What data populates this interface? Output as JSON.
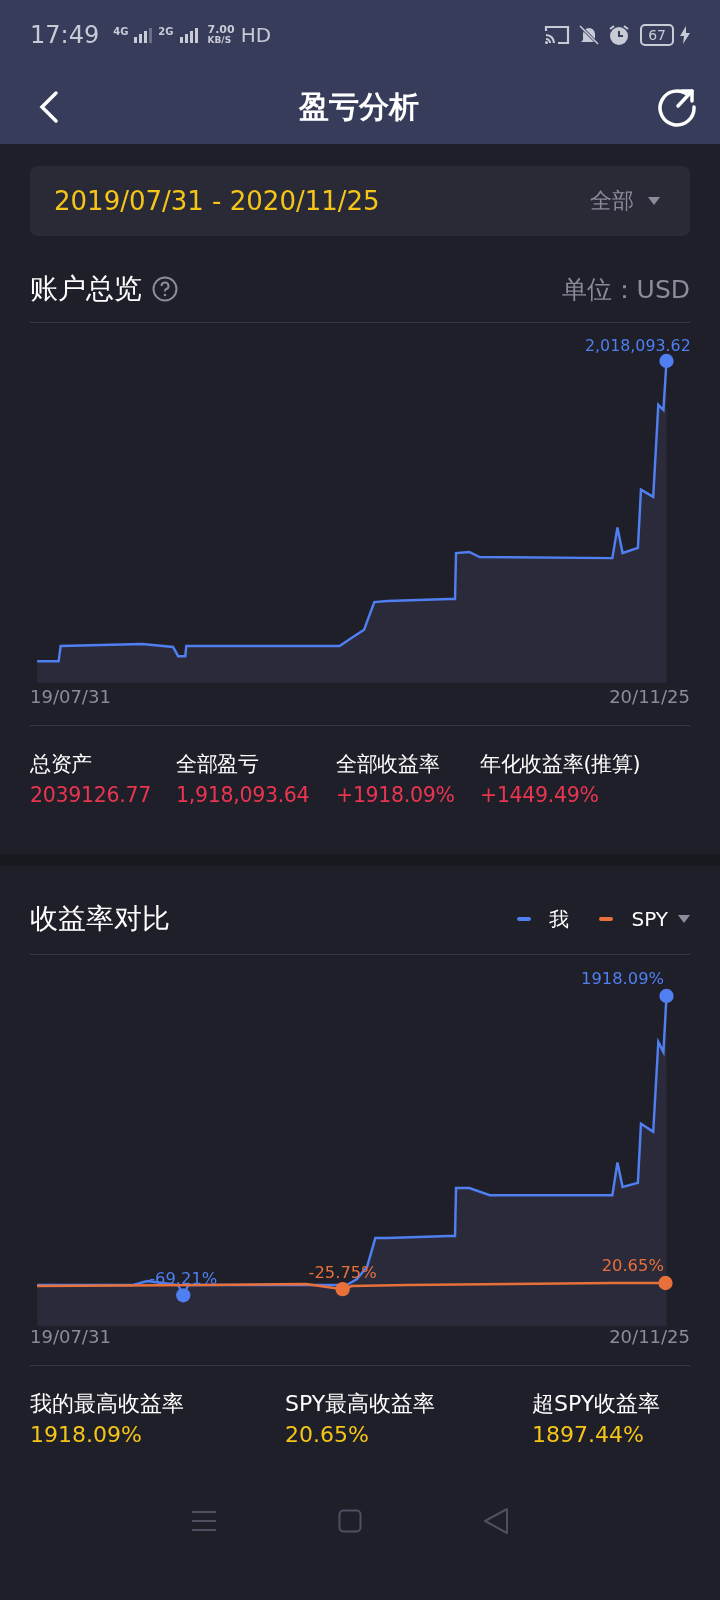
{
  "status_bar": {
    "time": "17:49",
    "network_1": "4G",
    "network_2": "2G",
    "speed": "7.00",
    "speed_unit": "KB/S",
    "hd": "HD",
    "battery": "67"
  },
  "header": {
    "title": "盈亏分析"
  },
  "date_filter": {
    "range": "2019/07/31 - 2020/11/25",
    "option": "全部"
  },
  "overview": {
    "title": "账户总览",
    "unit": "单位：USD",
    "chart": {
      "max_label": "2,018,093.62",
      "x_start": "19/07/31",
      "x_end": "20/11/25"
    },
    "stats": [
      {
        "label": "总资产",
        "value": "2039126.77"
      },
      {
        "label": "全部盈亏",
        "value": "1,918,093.64"
      },
      {
        "label": "全部收益率",
        "value": "+1918.09%"
      },
      {
        "label": "年化收益率(推算)",
        "value": "+1449.49%"
      }
    ]
  },
  "comparison": {
    "title": "收益率对比",
    "legend": [
      {
        "label": "我",
        "color": "#4f7ff0"
      },
      {
        "label": "SPY",
        "color": "#e8703a"
      }
    ],
    "chart": {
      "annotations": [
        {
          "text": "1918.09%",
          "kind": "mine"
        },
        {
          "text": "-69.21%",
          "kind": "mine"
        },
        {
          "text": "-25.75%",
          "kind": "benchmark"
        },
        {
          "text": "20.65%",
          "kind": "benchmark"
        }
      ],
      "x_start": "19/07/31",
      "x_end": "20/11/25"
    },
    "stats": [
      {
        "label": "我的最高收益率",
        "value": "1918.09%"
      },
      {
        "label": "SPY最高收益率",
        "value": "20.65%"
      },
      {
        "label": "超SPY收益率",
        "value": "1897.44%"
      }
    ]
  }
}
